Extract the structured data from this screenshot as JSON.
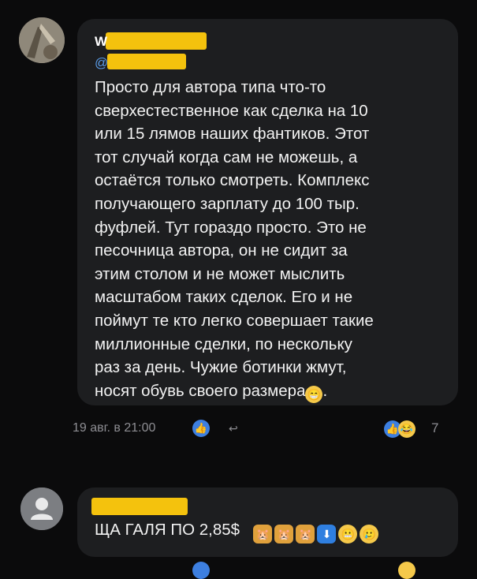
{
  "comment1": {
    "author_name": "W",
    "reply_to": "@",
    "lines": [
      "Просто для автора типа что-то",
      "сверхестественное  как сделка на 10",
      "или 15 лямов наших фантиков. Этот",
      "тот случай когда сам не можешь, а",
      "остаётся только  смотреть. Комплекс",
      "получающего зарплату до 100 тыр.",
      "фуфлей. Тут гораздо просто. Это не",
      "песочница автора, он не сидит за",
      "этим столом и не может мыслить",
      "масштабом таких сделок. Его и не",
      "поймут те кто легко совершает такие",
      "миллионные сделки, по нескольку",
      "раз за день. Чужие ботинки жмут,",
      "носят обувь своего размера"
    ],
    "end_punct": ".",
    "timestamp": "19 авг. в 21:00",
    "reaction_count": "7"
  },
  "comment2": {
    "text": "ЩА ГАЛЯ ПО 2,85$"
  },
  "colors": {
    "accent": "#3d7fe0",
    "highlight": "#f4c20d",
    "bubble": "#1d1e20",
    "background": "#0b0b0c"
  }
}
